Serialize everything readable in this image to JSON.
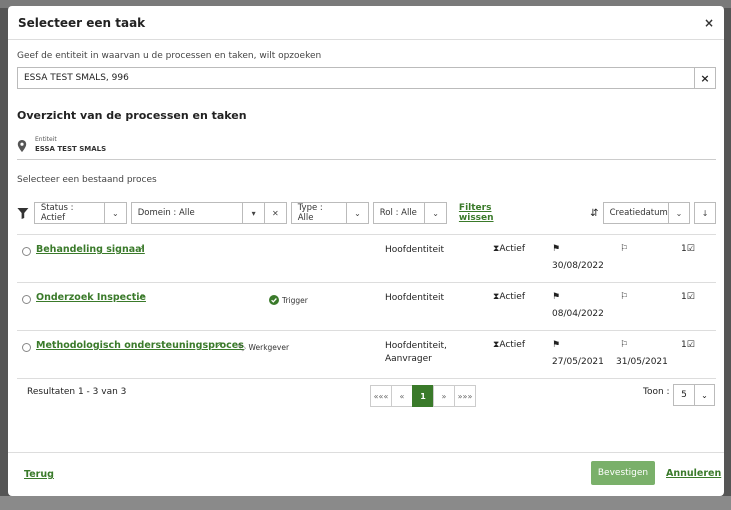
{
  "modal": {
    "title": "Selecteer een taak",
    "close": "×"
  },
  "entity_search": {
    "label": "Geef de entiteit in waarvan u de processen en taken, wilt opzoeken",
    "value": "ESSA TEST SMALS, 996",
    "clear": "×"
  },
  "overview": {
    "title": "Overzicht van de processen en taken",
    "entiteit_label": "Entiteit",
    "entiteit_value": "ESSA TEST SMALS",
    "select_label": "Selecteer een bestaand proces"
  },
  "filters": {
    "status": "Status : Actief",
    "domein": "Domein : Alle",
    "type": "Type : Alle",
    "rol": "Rol : Alle",
    "clear": "Filters wissen",
    "sort": "Creatiedatum"
  },
  "processes": [
    {
      "name": "Behandeling signaal",
      "tag": "",
      "domain_line1": "Hoofdentiteit",
      "domain_line2": "",
      "status": "Actief",
      "date1": "30/08/2022",
      "date2": "",
      "count": "1"
    },
    {
      "name": "Onderzoek Inspectie",
      "tag": "Trigger",
      "domain_line1": "Hoofdentiteit",
      "domain_line2": "",
      "status": "Actief",
      "date1": "08/04/2022",
      "date2": "",
      "count": "1"
    },
    {
      "name": "Methodologisch ondersteuningsproces",
      "tag": "Werkgever",
      "domain_line1": "Hoofdentiteit,",
      "domain_line2": "Aanvrager",
      "status": "Actief",
      "date1": "27/05/2021",
      "date2": "31/05/2021",
      "count": "1"
    }
  ],
  "pagination": {
    "results": "Resultaten 1 - 3 van 3",
    "first": "«««",
    "prev": "«",
    "current": "1",
    "next": "»",
    "last": "»»»",
    "toon_label": "Toon :",
    "toon_value": "5"
  },
  "footer": {
    "back": "Terug",
    "confirm": "Bevestigen",
    "cancel": "Annuleren"
  },
  "colors": {
    "accent": "#3a7a2a",
    "confirm_bg": "#7ab06a"
  }
}
